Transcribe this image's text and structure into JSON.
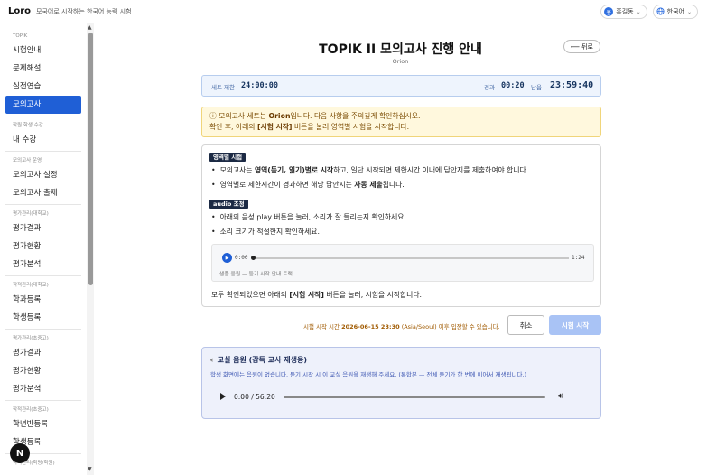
{
  "header": {
    "brand": "Loro",
    "tagline": "모국어로 시작하는 한국어 능력 시험",
    "user_name": "홍길동",
    "user_initial": "홍",
    "language": "한국어"
  },
  "sidebar": {
    "groups": [
      {
        "label": "TOPIK",
        "items": [
          "시험안내",
          "문제해설",
          "실전연습",
          "모의고사"
        ]
      },
      {
        "label": "학원 학생 수강",
        "items": [
          "내 수강"
        ]
      },
      {
        "label": "모의고사 운영",
        "items": [
          "모의고사 설정",
          "모의고사 출제"
        ]
      },
      {
        "label": "평가관리(대학교)",
        "items": [
          "평가결과",
          "평가현황",
          "평가분석"
        ]
      },
      {
        "label": "학적관리(대학교)",
        "items": [
          "학과등록",
          "학생등록"
        ]
      },
      {
        "label": "평가관리(초중고)",
        "items": [
          "평가결과",
          "평가현황",
          "평가분석"
        ]
      },
      {
        "label": "학적관리(초중고)",
        "items": [
          "학년반등록",
          "학생등록"
        ]
      },
      {
        "label": "학적관리(학당/학원)",
        "items": []
      }
    ],
    "active_item": "모의고사",
    "badge": "N"
  },
  "main": {
    "title": "TOPIK II 모의고사 진행 안내",
    "subtitle": "Orion",
    "back_label": "뒤로",
    "timer": {
      "set_limit_label": "세트 제한",
      "set_limit_value": "24:00:00",
      "elapsed_label": "경과",
      "elapsed_value": "00:20",
      "remaining_label": "남음",
      "remaining_value": "23:59:40"
    },
    "notice": {
      "line1_prefix": "ⓘ 모의고사 세트는 ",
      "set_name": "Orion",
      "line1_suffix": "입니다. 다음 사항을 주의깊게 확인하십시오.",
      "line2_prefix": "확인 후, 아래의 ",
      "line2_bold": "[시험 시작]",
      "line2_suffix": " 버튼을 눌러 영역별 시험을 시작합니다."
    },
    "section_tag": "영역별 시험",
    "section_bullets": [
      {
        "pre": "모의고사는 ",
        "bold": "영역(듣기, 읽기)별로 시작",
        "post": "하고, 일단 시작되면 제한시간 이내에 답안지를 제출하여야 합니다."
      },
      {
        "pre": "영역별로 제한시간이 경과하면 해당 답안지는 ",
        "bold": "자동 제출",
        "post": "됩니다."
      }
    ],
    "audio_tag": "audio 조정",
    "audio_bullets": [
      "아래의 음성 play 버튼을 눌러, 소리가 잘 들리는지 확인하세요.",
      "소리 크기가 적절한지 확인하세요."
    ],
    "sample_player": {
      "current": "0:00",
      "duration": "1:24",
      "progress": 0,
      "caption": "샘플 음원 — 듣기 시작 안내 트랙"
    },
    "card_footer": {
      "pre": "모두 확인되었으면 아래의 ",
      "bold": "[시험 시작]",
      "post": " 버튼을 눌러, 시험을 시작합니다."
    },
    "start_note": {
      "pre": "시험 시작 시간 ",
      "bold": "2026-06-15 23:30",
      "post": " (Asia/Seoul) 이후 입장할 수 있습니다."
    },
    "cancel_label": "취소",
    "start_label": "시험 시작",
    "class_audio": {
      "title": "교실 음원 (감독 교사 재생용)",
      "description": "학생 화면에는 음원이 없습니다. 듣기 시작 시 이 교실 음원을 재생해 주세요. (통합본 — 전체 듣기가 한 번에 이어서 재생됩니다.)",
      "time": "0:00 / 56:20",
      "progress": 0
    }
  }
}
